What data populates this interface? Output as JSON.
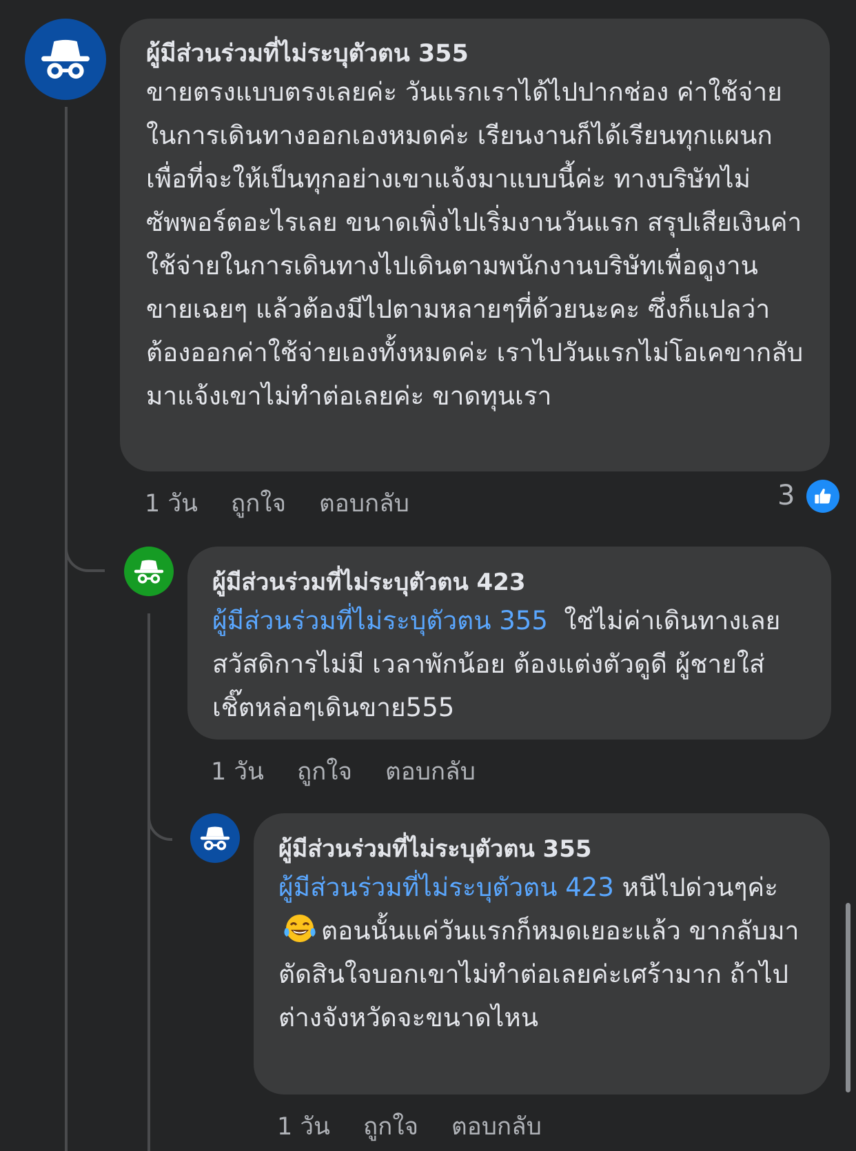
{
  "colors": {
    "background": "#242526",
    "bubble": "#3a3b3c",
    "text": "#e4e6eb",
    "meta": "#b0b3b8",
    "mention": "#5aa7ff",
    "avatar_blue": "#0b4ea2",
    "avatar_green": "#169c24",
    "like_badge": "#1d8cf8"
  },
  "comments": [
    {
      "author": "ผู้มีส่วนร่วมที่ไม่ระบุตัวตน 355",
      "avatar_icon": "incognito-icon",
      "text": "ขายตรงแบบตรงเลยค่ะ วันแรกเราได้ไปปากช่อง ค่าใช้จ่ายในการเดินทางออกเองหมดค่ะ เรียนงานก็ได้เรียนทุกแผนก เพื่อที่จะให้เป็นทุกอย่างเขาแจ้งมาแบบนี้ค่ะ ทางบริษัทไม่ซัพพอร์ตอะไรเลย ขนาดเพิ่งไปเริ่มงานวันแรก สรุปเสียเงินค่าใช้จ่ายในการเดินทางไปเดินตามพนักงานบริษัทเพื่อดูงานขายเฉยๆ แล้วต้องมีไปตามหลายๆที่ด้วยนะคะ ซึ่งก็แปลว่าต้องออกค่าใช้จ่ายเองทั้งหมดค่ะ เราไปวันแรกไม่โอเคขากลับมาแจ้งเขาไม่ทำต่อเลยค่ะ ขาดทุนเรา",
      "time": "1 วัน",
      "like_label": "ถูกใจ",
      "reply_label": "ตอบกลับ",
      "reaction_count": "3",
      "reaction_icon": "thumbs-up-icon"
    },
    {
      "author": "ผู้มีส่วนร่วมที่ไม่ระบุตัวตน 423",
      "avatar_icon": "incognito-icon",
      "mention": "ผู้มีส่วนร่วมที่ไม่ระบุตัวตน 355",
      "text": "ใช่ไม่ค่าเดินทางเลย สวัสดิการไม่มี เวลาพักน้อย ต้องแต่งตัวดูดี ผู้ชายใส่เชิ๊ตหล่อๆเดินขาย555",
      "time": "1 วัน",
      "like_label": "ถูกใจ",
      "reply_label": "ตอบกลับ"
    },
    {
      "author": "ผู้มีส่วนร่วมที่ไม่ระบุตัวตน 355",
      "avatar_icon": "incognito-icon",
      "mention": "ผู้มีส่วนร่วมที่ไม่ระบุตัวตน 423",
      "text_before_emoji": "หนีไปด่วนๆค่ะ",
      "emoji": "face-with-tears-of-joy-emoji",
      "text_after_emoji": "ตอนนั้นแค่วันแรกก็หมดเยอะแล้ว ขากลับมาตัดสินใจบอกเขาไม่ทำต่อเลยค่ะเศร้ามาก ถ้าไปต่างจังหวัดจะขนาดไหน",
      "time": "1 วัน",
      "like_label": "ถูกใจ",
      "reply_label": "ตอบกลับ"
    }
  ]
}
